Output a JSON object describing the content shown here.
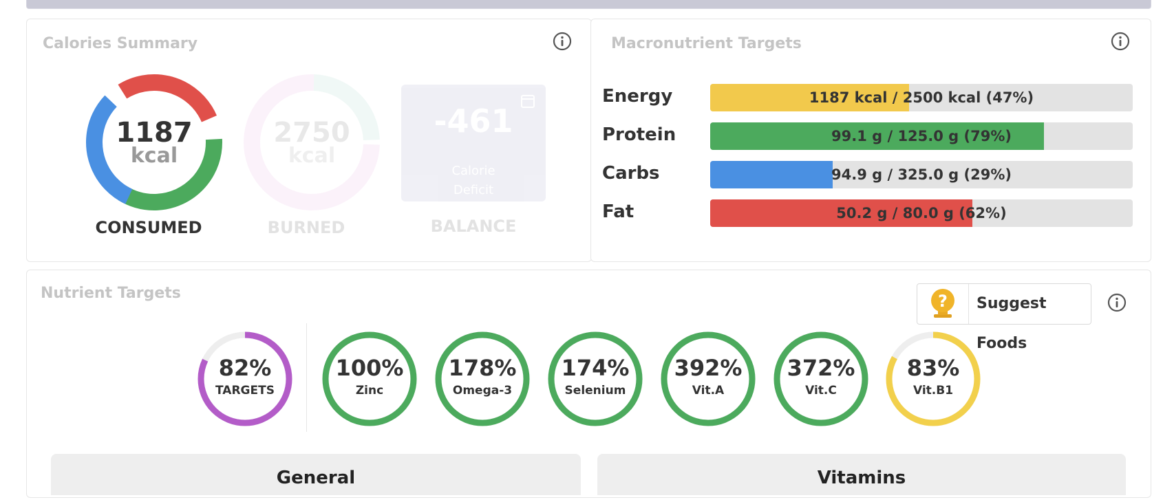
{
  "calories_summary": {
    "title": "Calories Summary",
    "consumed": {
      "value": "1187",
      "unit": "kcal",
      "label": "CONSUMED"
    },
    "burned": {
      "value": "2750",
      "unit": "kcal",
      "label": "BURNED"
    },
    "balance": {
      "value": "-461",
      "sub_line1": "Calorie",
      "sub_line2": "Deficit",
      "label": "BALANCE"
    }
  },
  "macronutrient_targets": {
    "title": "Macronutrient Targets",
    "rows": [
      {
        "label": "Energy",
        "text": "1187 kcal / 2500 kcal (47%)",
        "fraction": 0.47,
        "color": "#f2c94c"
      },
      {
        "label": "Protein",
        "text": "99.1 g / 125.0 g (79%)",
        "fraction": 0.79,
        "color": "#4caa5d"
      },
      {
        "label": "Carbs",
        "text": "94.9 g / 325.0 g (29%)",
        "fraction": 0.29,
        "color": "#4a90e2"
      },
      {
        "label": "Fat",
        "text": "50.2 g / 80.0 g (62%)",
        "fraction": 0.62,
        "color": "#e0504a"
      }
    ]
  },
  "nutrient_targets": {
    "title": "Nutrient Targets",
    "suggest_button": "Suggest Foods",
    "suggest_icon": "question-medal-icon",
    "items": [
      {
        "pct": "82%",
        "name": "TARGETS",
        "fraction": 0.82,
        "color": "#b35cc8"
      },
      {
        "pct": "100%",
        "name": "Zinc",
        "fraction": 1.0,
        "color": "#4caa5d"
      },
      {
        "pct": "178%",
        "name": "Omega-3",
        "fraction": 1.0,
        "color": "#4caa5d"
      },
      {
        "pct": "174%",
        "name": "Selenium",
        "fraction": 1.0,
        "color": "#4caa5d"
      },
      {
        "pct": "392%",
        "name": "Vit.A",
        "fraction": 1.0,
        "color": "#4caa5d"
      },
      {
        "pct": "372%",
        "name": "Vit.C",
        "fraction": 1.0,
        "color": "#4caa5d"
      },
      {
        "pct": "83%",
        "name": "Vit.B1",
        "fraction": 0.83,
        "color": "#f2d04c"
      }
    ]
  },
  "tabs": [
    {
      "label": "General"
    },
    {
      "label": "Vitamins"
    }
  ],
  "icons": {
    "info": "info-icon",
    "balance": "lock-icon"
  }
}
